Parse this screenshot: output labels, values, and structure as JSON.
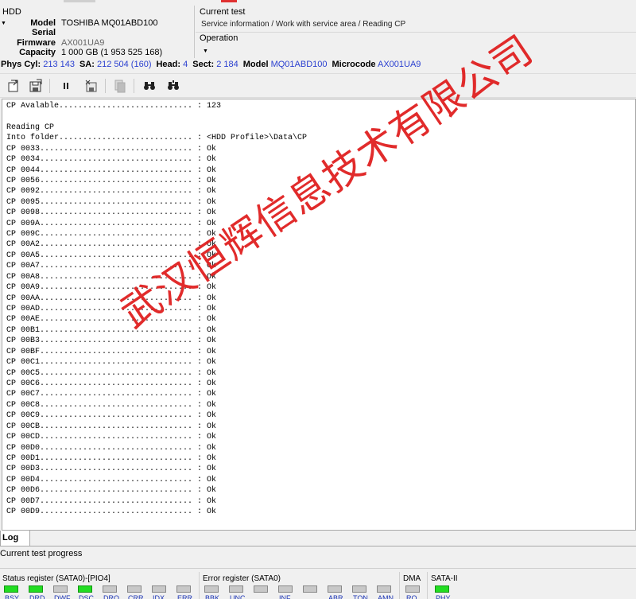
{
  "hdd": {
    "title": "HDD",
    "model_label": "Model",
    "model": "TOSHIBA MQ01ABD100",
    "serial_label": "Serial",
    "serial": "",
    "firmware_label": "Firmware",
    "firmware": "AX001UA9",
    "capacity_label": "Capacity",
    "capacity": "1 000 GB (1 953 525 168)"
  },
  "current_test": {
    "title": "Current test",
    "value": "Service information / Work with service area / Reading CP"
  },
  "operation": {
    "title": "Operation",
    "value": ""
  },
  "info_bar": {
    "phys_cyl_label": "Phys Cyl:",
    "phys_cyl": "213 143",
    "sa_label": "SA:",
    "sa": "212 504 (160)",
    "head_label": "Head:",
    "head": "4",
    "sect_label": "Sect:",
    "sect": "2 184",
    "model_label": "Model",
    "model": "MQ01ABD100",
    "microcode_label": "Microcode",
    "microcode": "AX001UA9"
  },
  "toolbar": {
    "icons": [
      "export-icon",
      "save-icon",
      "pause-icon",
      "stop-save-icon",
      "copy-icon",
      "find-icon",
      "find-next-icon"
    ]
  },
  "log": {
    "lines": [
      "CP Avalable............................ : 123",
      "",
      "Reading CP",
      "Into folder............................ : <HDD Profile>\\Data\\CP",
      "CP 0033................................ : Ok",
      "CP 0034................................ : Ok",
      "CP 0044................................ : Ok",
      "CP 0056................................ : Ok",
      "CP 0092................................ : Ok",
      "CP 0095................................ : Ok",
      "CP 0098................................ : Ok",
      "CP 009A................................ : Ok",
      "CP 009C................................ : Ok",
      "CP 00A2................................ : Ok",
      "CP 00A5................................ : Ok",
      "CP 00A7................................ : Ok",
      "CP 00A8................................ : Ok",
      "CP 00A9................................ : Ok",
      "CP 00AA................................ : Ok",
      "CP 00AD................................ : Ok",
      "CP 00AE................................ : Ok",
      "CP 00B1................................ : Ok",
      "CP 00B3................................ : Ok",
      "CP 00BF................................ : Ok",
      "CP 00C1................................ : Ok",
      "CP 00C5................................ : Ok",
      "CP 00C6................................ : Ok",
      "CP 00C7................................ : Ok",
      "CP 00C8................................ : Ok",
      "CP 00C9................................ : Ok",
      "CP 00CB................................ : Ok",
      "CP 00CD................................ : Ok",
      "CP 00D0................................ : Ok",
      "CP 00D1................................ : Ok",
      "CP 00D3................................ : Ok",
      "CP 00D4................................ : Ok",
      "CP 00D6................................ : Ok",
      "CP 00D7................................ : Ok",
      "CP 00D9................................ : Ok"
    ]
  },
  "watermark": "武汉恒辉信息技术有限公司",
  "tabs": {
    "log": "Log"
  },
  "progress": {
    "label": "Current test progress"
  },
  "status": {
    "title": "Status register (SATA0)-[PIO4]",
    "leds": [
      {
        "label": "BSY",
        "on": true
      },
      {
        "label": "DRD",
        "on": true
      },
      {
        "label": "DWF",
        "on": false
      },
      {
        "label": "DSC",
        "on": true
      },
      {
        "label": "DRQ",
        "on": false
      },
      {
        "label": "CRR",
        "on": false
      },
      {
        "label": "IDX",
        "on": false
      },
      {
        "label": "ERR",
        "on": false
      }
    ]
  },
  "error": {
    "title": "Error register (SATA0)",
    "leds": [
      {
        "label": "BBK",
        "on": false
      },
      {
        "label": "UNC",
        "on": false
      },
      {
        "label": "",
        "on": false
      },
      {
        "label": "INF",
        "on": false
      },
      {
        "label": "",
        "on": false
      },
      {
        "label": "ABR",
        "on": false
      },
      {
        "label": "TON",
        "on": false
      },
      {
        "label": "AMN",
        "on": false
      }
    ]
  },
  "dma": {
    "title": "DMA",
    "leds": [
      {
        "label": "RQ",
        "on": false
      }
    ]
  },
  "sata": {
    "title": "SATA-II",
    "leds": [
      {
        "label": "PHY",
        "on": true
      }
    ]
  },
  "colors": {
    "led_on": "#22dd22",
    "led_off": "#c8c8c8",
    "link_blue": "#2a3fd0",
    "watermark": "#e02020"
  }
}
